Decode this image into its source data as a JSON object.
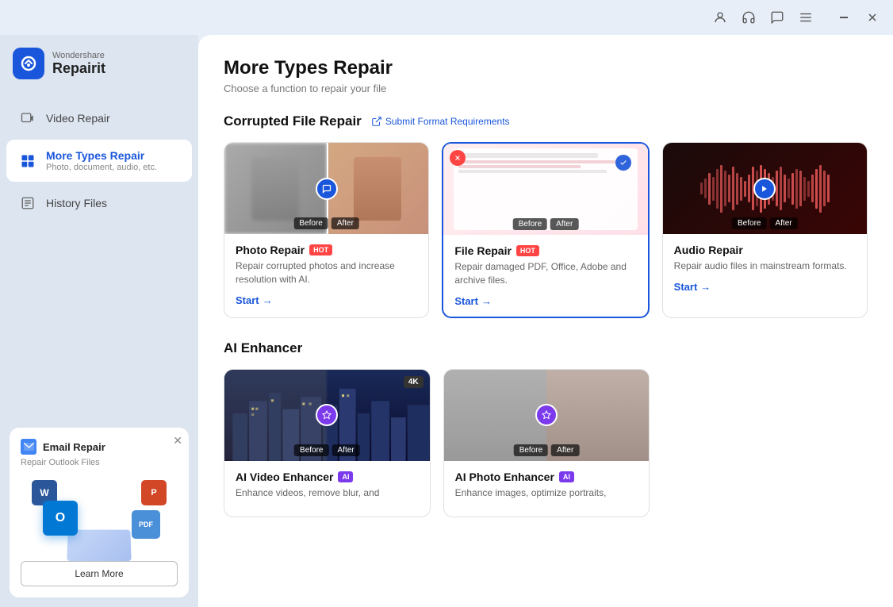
{
  "app": {
    "name": "Repairit",
    "brand": "Wondershare"
  },
  "titlebar": {
    "icons": [
      {
        "name": "account-icon",
        "symbol": "👤"
      },
      {
        "name": "headset-icon",
        "symbol": "🎧"
      },
      {
        "name": "chat-icon",
        "symbol": "💬"
      },
      {
        "name": "menu-icon",
        "symbol": "☰"
      }
    ],
    "controls": {
      "minimize": "—",
      "close": "✕"
    }
  },
  "sidebar": {
    "nav_items": [
      {
        "id": "video-repair",
        "label": "Video Repair",
        "active": false
      },
      {
        "id": "more-types-repair",
        "label": "More Types Repair",
        "subtitle": "Photo, document, audio, etc.",
        "active": true
      },
      {
        "id": "history-files",
        "label": "History Files",
        "active": false
      }
    ],
    "promo": {
      "title": "Email Repair",
      "subtitle": "Repair Outlook Files",
      "learn_more": "Learn More"
    }
  },
  "main": {
    "title": "More Types Repair",
    "subtitle": "Choose a function to repair your file",
    "sections": [
      {
        "id": "corrupted-file-repair",
        "title": "Corrupted File Repair",
        "submit_link": "Submit Format Requirements",
        "cards": [
          {
            "id": "photo-repair",
            "title": "Photo Repair",
            "badge": "HOT",
            "badge_type": "hot",
            "description": "Repair corrupted photos and increase resolution with AI.",
            "start_label": "Start",
            "image_type": "photo-split",
            "before_label": "Before",
            "after_label": "After"
          },
          {
            "id": "file-repair",
            "title": "File Repair",
            "badge": "HOT",
            "badge_type": "hot",
            "description": "Repair damaged PDF, Office, Adobe and archive files.",
            "start_label": "Start",
            "image_type": "file",
            "before_label": "Before",
            "after_label": "After",
            "selected": true
          },
          {
            "id": "audio-repair",
            "title": "Audio Repair",
            "badge": null,
            "description": "Repair audio files in mainstream formats.",
            "start_label": "Start",
            "image_type": "audio",
            "before_label": "Before",
            "after_label": "After"
          }
        ]
      },
      {
        "id": "ai-enhancer",
        "title": "AI Enhancer",
        "cards": [
          {
            "id": "ai-video-enhancer",
            "title": "AI Video Enhancer",
            "badge": "AI",
            "badge_type": "ai",
            "description": "Enhance videos, remove blur, and",
            "image_type": "city",
            "badge_corner": "4K",
            "before_label": "Before",
            "after_label": "After"
          },
          {
            "id": "ai-photo-enhancer",
            "title": "AI Photo Enhancer",
            "badge": "AI",
            "badge_type": "ai",
            "description": "Enhance images, optimize portraits,",
            "image_type": "portrait",
            "before_label": "Before",
            "after_label": "After"
          }
        ]
      }
    ]
  }
}
